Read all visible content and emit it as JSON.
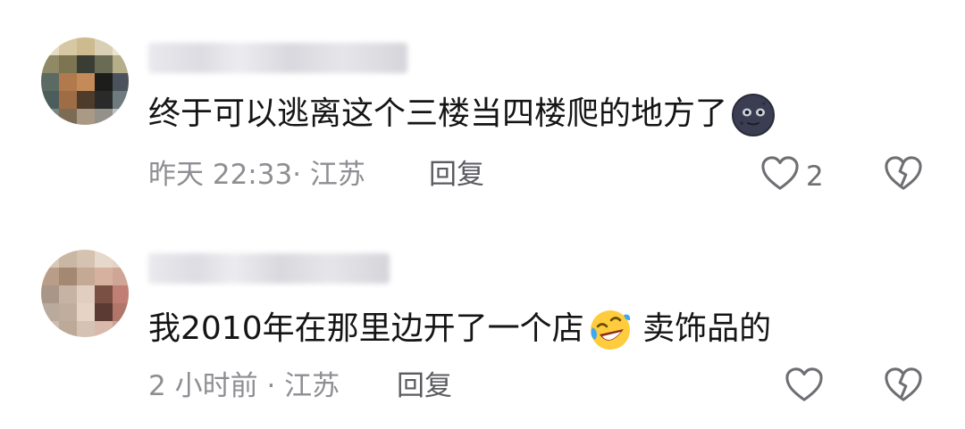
{
  "comments": [
    {
      "text": "终于可以逃离这个三楼当四楼爬的地方了",
      "emoji": "new-moon-face",
      "time": "昨天 22:33",
      "location_sep": "· 江苏",
      "reply_label": "回复",
      "like_count": "2"
    },
    {
      "text": "我2010年在那里边开了一个店",
      "emoji": "rolling-laughing-face",
      "text_after": " 卖饰品的",
      "time": "2 小时前",
      "location_sep": "· 江苏",
      "reply_label": "回复",
      "like_count": ""
    }
  ],
  "colors": {
    "text": "#151515",
    "meta": "#8e8e93",
    "icon": "#6e6e73"
  }
}
